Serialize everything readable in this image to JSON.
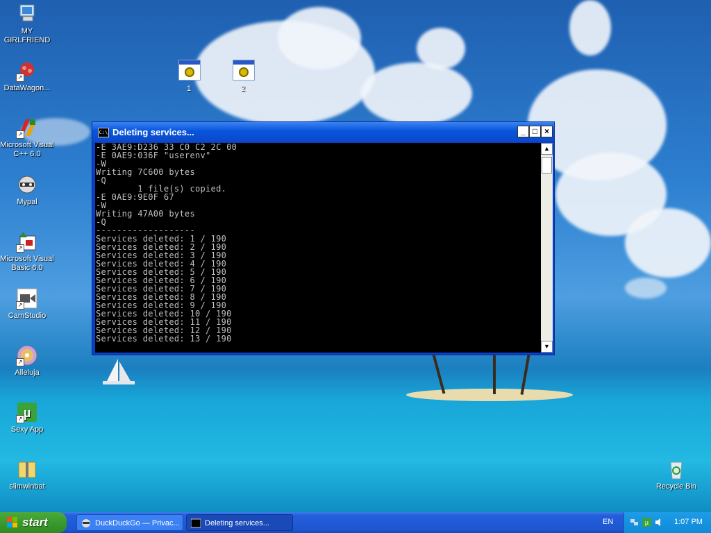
{
  "desktop": {
    "icons": [
      {
        "label": "MY GIRLFRIEND"
      },
      {
        "label": "DataWagon..."
      },
      {
        "label": "Microsoft Visual C++ 6.0"
      },
      {
        "label": "Mypal"
      },
      {
        "label": "Microsoft Visual Basic 6.0"
      },
      {
        "label": "CamStudio"
      },
      {
        "label": "Alleluja"
      },
      {
        "label": "Sexy App"
      },
      {
        "label": "slimwinbat"
      },
      {
        "label": "Recycle Bin"
      }
    ],
    "mini_icons": [
      {
        "label": "1"
      },
      {
        "label": "2"
      }
    ]
  },
  "window": {
    "title": "Deleting services...",
    "icon": "cmd-icon",
    "minimize": "_",
    "maximize": "□",
    "close": "×",
    "console_lines": [
      "-E 3AE9:D236 33 C0 C2 2C 00",
      "-E 0AE9:036F \"userenv\"",
      "-W",
      "Writing 7C600 bytes",
      "-Q",
      "        1 file(s) copied.",
      "-E 0AE9:9E0F 67",
      "-W",
      "Writing 47A00 bytes",
      "-Q",
      "-------------------",
      "Services deleted: 1 / 190",
      "Services deleted: 2 / 190",
      "Services deleted: 3 / 190",
      "Services deleted: 4 / 190",
      "Services deleted: 5 / 190",
      "Services deleted: 6 / 190",
      "Services deleted: 7 / 190",
      "Services deleted: 8 / 190",
      "Services deleted: 9 / 190",
      "Services deleted: 10 / 190",
      "Services deleted: 11 / 190",
      "Services deleted: 12 / 190",
      "Services deleted: 13 / 190"
    ]
  },
  "taskbar": {
    "start_label": "start",
    "tasks": [
      {
        "label": "DuckDuckGo — Privac...",
        "icon": "raccoon-icon"
      },
      {
        "label": "Deleting services...",
        "icon": "cmd-icon"
      }
    ],
    "language": "EN",
    "clock": "1:07 PM"
  },
  "colors": {
    "taskbar": "#245edc",
    "start": "#3a9a2c",
    "console_bg": "#000000",
    "console_text": "#c0c0c0"
  }
}
